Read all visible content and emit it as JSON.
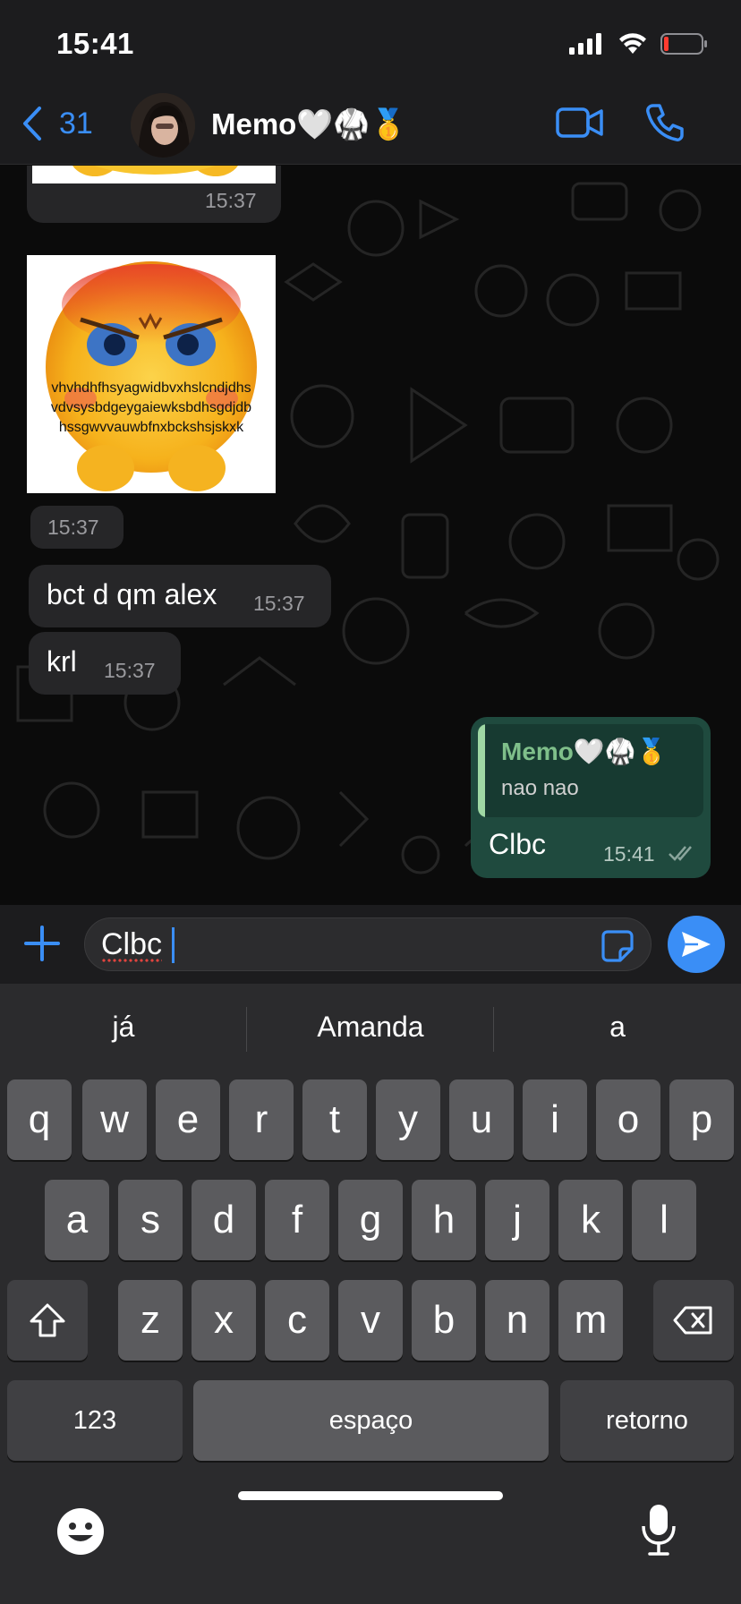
{
  "status_bar": {
    "time": "15:41"
  },
  "header": {
    "back_count": "31",
    "contact_name": "Memo🤍🥋🥇"
  },
  "messages": [
    {
      "type": "image",
      "direction": "in",
      "time": "15:37",
      "partial": true
    },
    {
      "type": "image",
      "direction": "in",
      "time": "15:37",
      "image_text": [
        "vhvhdhfhsyagwidbvxhslcndjdhs",
        "vdvsysbdgeygaiewksbdhsgdjdb",
        "hssgwvvauwbfnxbckshsjskxk"
      ]
    },
    {
      "type": "text",
      "direction": "in",
      "text": "bct d qm alex",
      "time": "15:37"
    },
    {
      "type": "text",
      "direction": "in",
      "text": "krl",
      "time": "15:37"
    },
    {
      "type": "reply",
      "direction": "out",
      "quoted_author": "Memo🤍🥋🥇",
      "quoted_text": "nao nao",
      "text": "Clbc",
      "time": "15:41",
      "status": "read"
    }
  ],
  "input": {
    "value": "Clbc"
  },
  "keyboard": {
    "suggestions": [
      "já",
      "Amanda",
      "a"
    ],
    "row1": [
      "q",
      "w",
      "e",
      "r",
      "t",
      "y",
      "u",
      "i",
      "o",
      "p"
    ],
    "row2": [
      "a",
      "s",
      "d",
      "f",
      "g",
      "h",
      "j",
      "k",
      "l"
    ],
    "row3": [
      "z",
      "x",
      "c",
      "v",
      "b",
      "n",
      "m"
    ],
    "numbers_label": "123",
    "space_label": "espaço",
    "return_label": "retorno"
  },
  "colors": {
    "accent": "#3a8ef6",
    "bubble_out": "#1f4a3e",
    "bubble_in": "#262628",
    "quote_name": "#7fbf8a"
  }
}
